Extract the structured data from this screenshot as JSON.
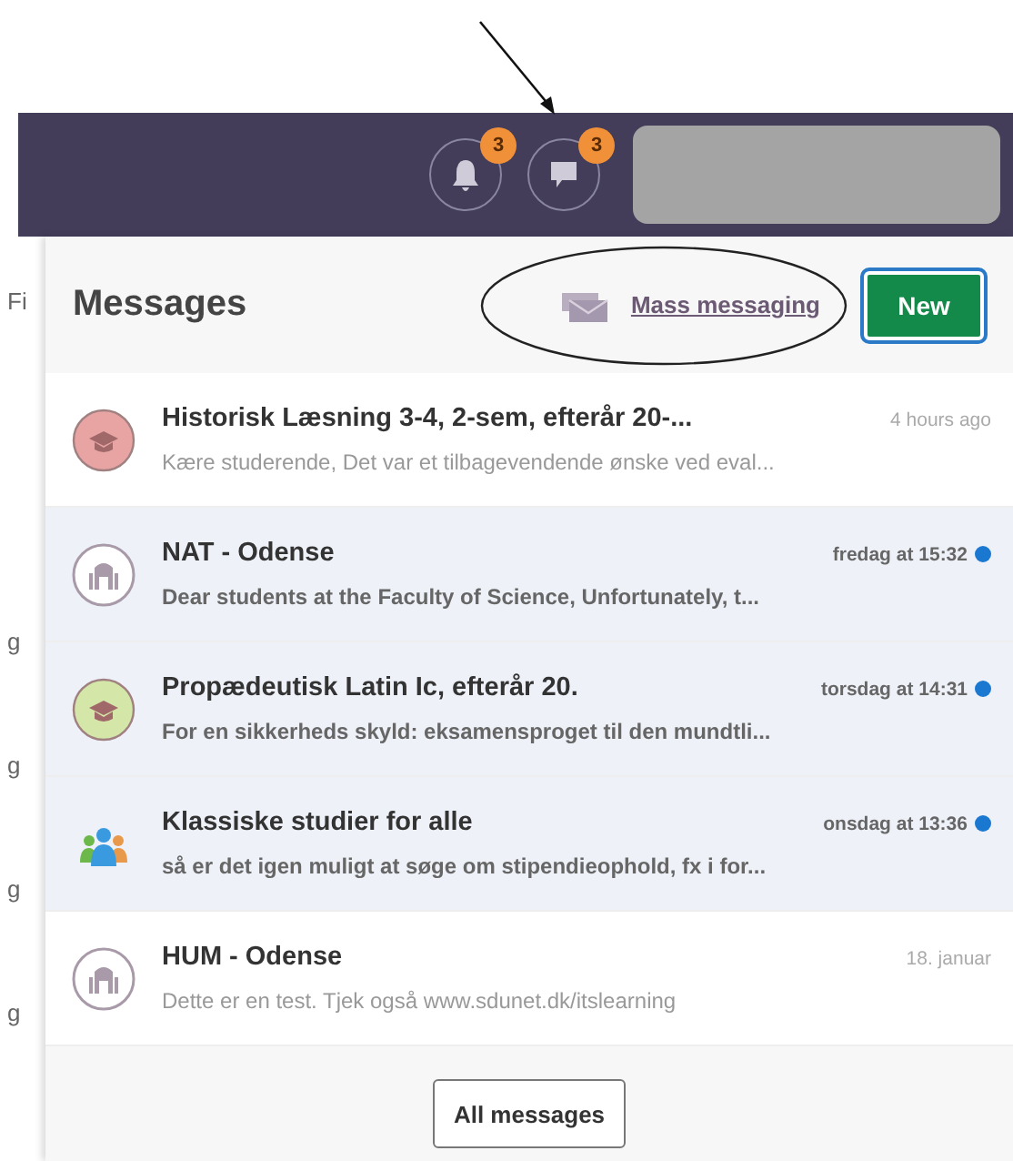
{
  "background_page": {
    "fragments": [
      "Fi",
      "g",
      "g",
      "g",
      "g"
    ]
  },
  "top_bar": {
    "notifications": {
      "badge": "3"
    },
    "messages": {
      "badge": "3"
    }
  },
  "messages_panel": {
    "title": "Messages",
    "mass_messaging_link": "Mass messaging",
    "new_button": "New",
    "items": [
      {
        "kind": "course",
        "color": "#e8a3a3",
        "title": "Historisk Læsning 3-4, 2-sem, efterår 20-...",
        "time": "4 hours ago",
        "preview": "Kære studerende, Det var et tilbagevendende ønske ved eval...",
        "unread": false
      },
      {
        "kind": "organisation",
        "title": "NAT - Odense",
        "time": "fredag at 15:32",
        "preview": "Dear students at the Faculty of Science, Unfortunately, t...",
        "unread": true
      },
      {
        "kind": "course",
        "color": "#d4e6a8",
        "title": "Propædeutisk Latin Ic, efterår 20.",
        "time": "torsdag at 14:31",
        "preview": "For en sikkerheds skyld: eksamensproget til den mundtli...",
        "unread": true
      },
      {
        "kind": "group",
        "title": "Klassiske studier for alle",
        "time": "onsdag at 13:36",
        "preview": "så er det igen muligt at søge om stipendieophold, fx i for...",
        "unread": true
      },
      {
        "kind": "organisation",
        "title": "HUM - Odense",
        "time": "18. januar",
        "preview": "Dette er en test. Tjek også www.sdunet.dk/itslearning",
        "unread": false
      }
    ],
    "all_messages_button": "All messages"
  }
}
